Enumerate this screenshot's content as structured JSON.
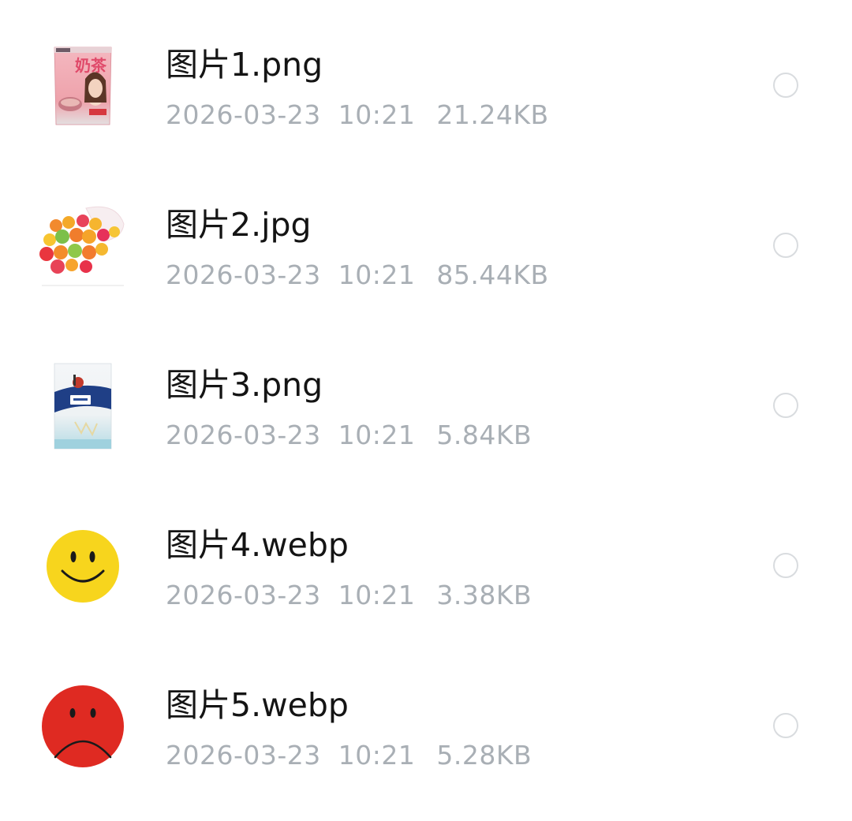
{
  "files": [
    {
      "name": "图片1.png",
      "date": "2026-03-23",
      "time": "10:21",
      "size": "21.24KB",
      "thumbnail": "milk-tea-package-thumbnail",
      "thumbnail_text": "奶茶",
      "selected": false
    },
    {
      "name": "图片2.jpg",
      "date": "2026-03-23",
      "time": "10:21",
      "size": "85.44KB",
      "thumbnail": "gummy-candies-thumbnail",
      "selected": false
    },
    {
      "name": "图片3.png",
      "date": "2026-03-23",
      "time": "10:21",
      "size": "5.84KB",
      "thumbnail": "powder-bag-thumbnail",
      "selected": false
    },
    {
      "name": "图片4.webp",
      "date": "2026-03-23",
      "time": "10:21",
      "size": "3.38KB",
      "thumbnail": "yellow-smiley-face-thumbnail",
      "face_color": "#f7d51d",
      "selected": false
    },
    {
      "name": "图片5.webp",
      "date": "2026-03-23",
      "time": "10:21",
      "size": "5.28KB",
      "thumbnail": "red-sad-face-thumbnail",
      "face_color": "#df2a22",
      "selected": false
    }
  ],
  "colors": {
    "name_text": "#141414",
    "meta_text": "#a9afb5",
    "radio_border": "#d9dcdf",
    "background": "#ffffff"
  }
}
